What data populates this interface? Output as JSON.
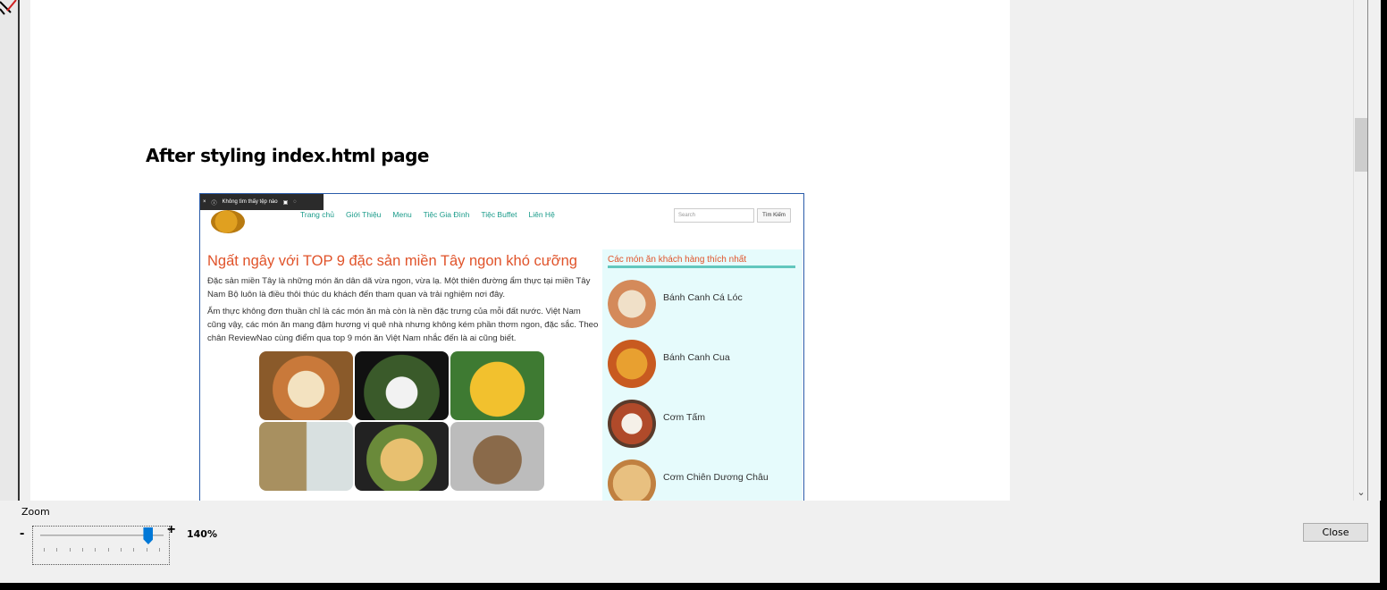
{
  "document": {
    "heading": "After styling index.html page"
  },
  "embedded_page": {
    "toolbar": {
      "close_glyph": "×",
      "info_glyph": "ⓘ",
      "message": "Không tìm thấy tệp nào"
    },
    "nav": [
      "Trang chủ",
      "Giới Thiệu",
      "Menu",
      "Tiệc Gia Đình",
      "Tiệc Buffet",
      "Liên Hệ"
    ],
    "search_placeholder": "Search",
    "search_button": "Tìm Kiếm",
    "title": "Ngất ngây với TOP 9 đặc sản miền Tây ngon khó cưỡng",
    "paragraph1": "Đặc sản miền Tây là những món ăn dân dã vừa ngon, vừa lạ. Một thiên đường ẩm thực tại miền Tây Nam Bộ luôn là điều thôi thúc du khách đến tham quan và trải nghiệm nơi đây.",
    "paragraph2": "Ẩm thực không đơn thuần chỉ là các món ăn mà còn là nền đặc trưng của mỗi đất nước. Việt Nam cũng vậy, các món ăn mang đậm hương vị quê nhà nhưng không kém phần thơm ngon, đặc sắc. Theo chân ReviewNao cùng điểm qua top 9 món ăn Việt Nam nhắc đến là ai cũng biết.",
    "sidebar_title": "Các món ăn khách hàng thích nhất",
    "sidebar_items": [
      "Bánh Canh Cá Lóc",
      "Bánh Canh Cua",
      "Cơm Tấm",
      "Cơm Chiên Dương Châu"
    ]
  },
  "zoom": {
    "label": "Zoom",
    "minus": "-",
    "plus": "+",
    "value": "140%",
    "level_fraction": 0.88
  },
  "close_label": "Close",
  "colors": {
    "accent": "#0078d7",
    "title_orange": "#e0532a",
    "nav_teal": "#1a9b8a",
    "sidebar_bg": "#e6fbfc"
  }
}
